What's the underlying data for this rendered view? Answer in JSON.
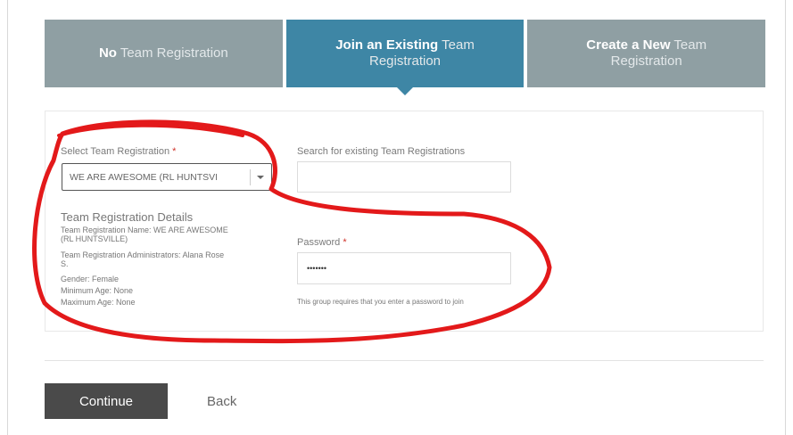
{
  "tabs": [
    {
      "bold": "No",
      "rest": " Team Registration"
    },
    {
      "bold": "Join an Existing",
      "rest": " Team Registration"
    },
    {
      "bold": "Create a New",
      "rest": " Team Registration"
    }
  ],
  "form": {
    "select_label": "Select Team Registration",
    "select_value": "WE ARE AWESOME (RL HUNTSVI",
    "search_label": "Search for existing Team Registrations",
    "search_value": "",
    "password_label": "Password",
    "password_value": "•••••••",
    "password_hint": "This group requires that you enter a password to join",
    "required_mark": "*"
  },
  "details": {
    "title": "Team Registration Details",
    "name_line1": "Team Registration Name: WE ARE AWESOME",
    "name_line2": "(RL HUNTSVILLE)",
    "admin_line1": "Team Registration Administrators: Alana Rose",
    "admin_line2": "S.",
    "gender": "Gender: Female",
    "min_age": "Minimum Age: None",
    "max_age": "Maximum Age: None"
  },
  "actions": {
    "continue_label": "Continue",
    "back_label": "Back"
  },
  "colors": {
    "tab_inactive": "#8f9fa3",
    "tab_active": "#3e86a5",
    "annotation": "#e3191a",
    "continue_bg": "#4a4a4a"
  }
}
